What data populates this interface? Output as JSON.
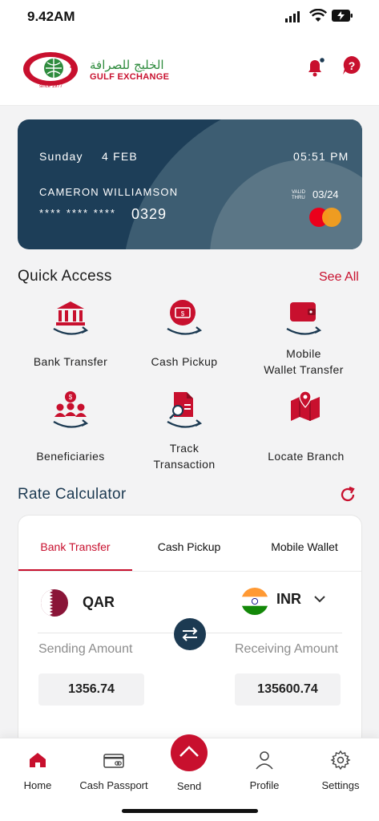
{
  "status_bar": {
    "time": "9.42AM"
  },
  "header": {
    "brand_arabic": "الخليج للصرافة",
    "brand_english": "GULF EXCHANGE",
    "logo_tagline": "since 1977"
  },
  "card": {
    "day": "Sunday",
    "date": "4 FEB",
    "time": "05:51 PM",
    "holder": "CAMERON WILLIAMSON",
    "masked_prefix": "**** **** ****",
    "last4": "0329",
    "valid_label_1": "VALID",
    "valid_label_2": "THRU",
    "expiry": "03/24"
  },
  "quick_access": {
    "title": "Quick Access",
    "see_all": "See All",
    "items": [
      {
        "label": "Bank Transfer"
      },
      {
        "label": "Cash Pickup"
      },
      {
        "label_line1": "Mobile",
        "label_line2": "Wallet Transfer"
      },
      {
        "label": "Beneficiaries"
      },
      {
        "label_line1": "Track",
        "label_line2": "Transaction"
      },
      {
        "label": "Locate Branch"
      }
    ]
  },
  "rate_calculator": {
    "title": "Rate Calculator",
    "tabs": [
      "Bank Transfer",
      "Cash Pickup",
      "Mobile Wallet"
    ],
    "active_tab": "Bank Transfer",
    "from_currency": "QAR",
    "to_currency": "INR",
    "sending_label": "Sending Amount",
    "receiving_label": "Receiving Amount",
    "sending_amount": "1356.74",
    "receiving_amount": "135600.74"
  },
  "bottom_nav": {
    "items": [
      "Home",
      "Cash Passport",
      "Send",
      "Profile",
      "Settings"
    ],
    "active": "Home"
  },
  "colors": {
    "brand_red": "#c8102e",
    "card_navy": "#1d3e58",
    "accent_navy": "#1c3a52"
  }
}
